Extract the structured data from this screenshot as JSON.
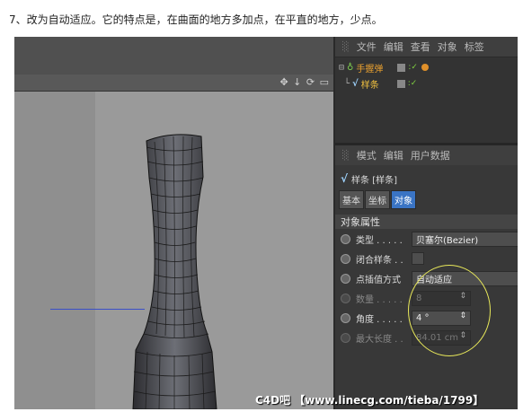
{
  "caption": "7、改为自动适应。它的特点是，在曲面的地方多加点，在平直的地方，少点。",
  "viewport": {
    "nav_icons": "✥ ↓ ⟳ ▭"
  },
  "object_manager": {
    "menu": [
      "文件",
      "编辑",
      "查看",
      "对象",
      "标签"
    ],
    "objects": [
      {
        "name": "手握弹"
      },
      {
        "name": "样条"
      }
    ]
  },
  "attribute_manager": {
    "menu": [
      "模式",
      "编辑",
      "用户数据"
    ],
    "title": "样条 [样条]",
    "tabs": [
      "基本",
      "坐标",
      "对象"
    ],
    "active_tab": "对象",
    "section": "对象属性",
    "properties": [
      {
        "label": "类型 . . . . .",
        "value": "贝塞尔(Bezier)"
      },
      {
        "label": "闭合样条 . .",
        "value": ""
      },
      {
        "label": "点插值方式",
        "value": "自动适应"
      },
      {
        "label": "数量 . . . . .",
        "value": "8"
      },
      {
        "label": "角度 . . . . .",
        "value": "4 °"
      },
      {
        "label": "最大长度 . .",
        "value": "84.01 cm"
      }
    ]
  },
  "watermark": "C4D吧 【www.linecg.com/tieba/1799】",
  "colors": {
    "active_tab": "#3a74c4",
    "highlight_ellipse": "#e8e85a",
    "axis_line": "#3a4fc8"
  }
}
